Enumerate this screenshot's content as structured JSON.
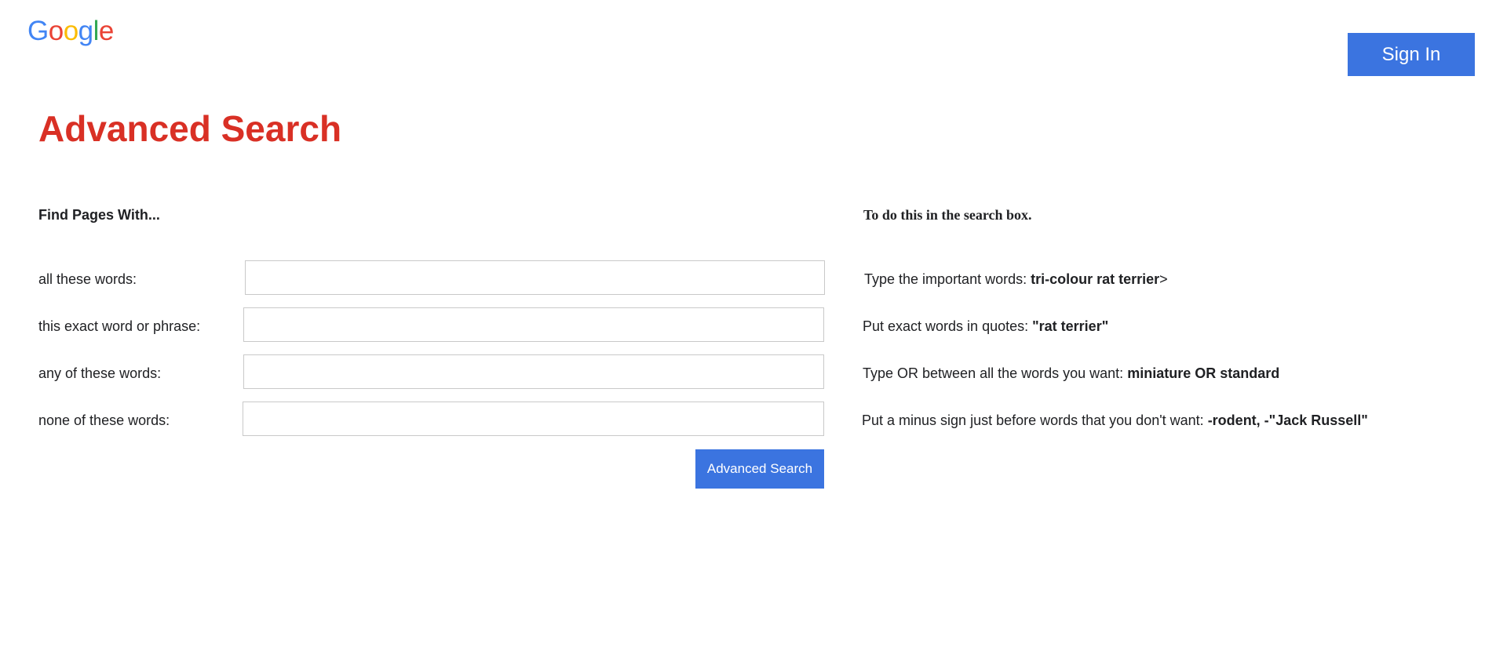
{
  "logo": {
    "letters": [
      "G",
      "o",
      "o",
      "g",
      "l",
      "e"
    ],
    "colors": [
      "#4285f4",
      "#ea4335",
      "#fbbc05",
      "#4285f4",
      "#34a853",
      "#ea4335"
    ]
  },
  "header": {
    "sign_in_label": "Sign In"
  },
  "page_title": "Advanced Search",
  "columns": {
    "left_heading": "Find Pages With...",
    "right_heading": "To do this in the search box."
  },
  "rows": [
    {
      "label": "all these words:",
      "value": "",
      "hint_text": "Type the important words: ",
      "hint_example": "tri-colour rat terrier",
      "hint_suffix": ">"
    },
    {
      "label": "this exact word or phrase:",
      "value": "",
      "hint_text": "Put exact words in quotes: ",
      "hint_example": "\"rat terrier\"",
      "hint_suffix": ""
    },
    {
      "label": "any of these words:",
      "value": "",
      "hint_text": "Type OR between all the words you want: ",
      "hint_example": "miniature OR standard",
      "hint_suffix": ""
    },
    {
      "label": "none of these words:",
      "value": "",
      "hint_text": "Put a minus sign just before words that you don't want: ",
      "hint_example": "-rodent, -\"Jack Russell\"",
      "hint_suffix": ""
    }
  ],
  "submit_label": "Advanced Search",
  "colors": {
    "accent": "#3b74e0",
    "title": "#d93025"
  }
}
